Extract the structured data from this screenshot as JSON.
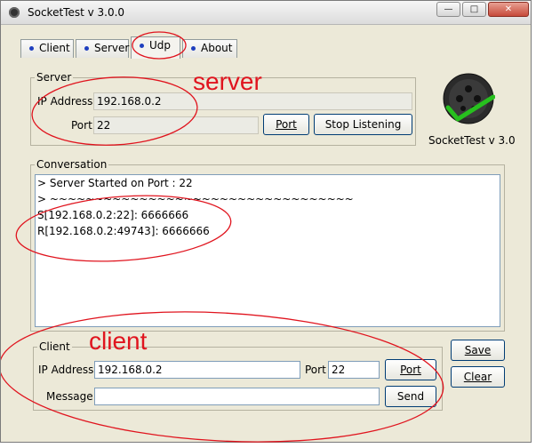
{
  "window": {
    "title": "SocketTest v 3.0.0",
    "controls": {
      "minimize": "—",
      "maximize": "□",
      "close": "✕"
    }
  },
  "tabs": [
    {
      "label": "Client",
      "active": false
    },
    {
      "label": "Server",
      "active": false
    },
    {
      "label": "Udp",
      "active": true
    },
    {
      "label": "About",
      "active": false
    }
  ],
  "server": {
    "group_title": "Server",
    "ip_label": "IP Address",
    "ip_value": "192.168.0.2",
    "port_label": "Port",
    "port_value": "22",
    "port_button": "Port",
    "stop_button": "Stop Listening"
  },
  "logo": {
    "caption": "SocketTest v 3.0"
  },
  "conversation": {
    "group_title": "Conversation",
    "lines": [
      "> Server Started on Port : 22",
      "> ~~~~~~~~~~~~~~~~~~~~~~~~~~~~~~~~~~",
      "S[192.168.0.2:22]: 6666666",
      "R[192.168.0.2:49743]: 6666666"
    ]
  },
  "client": {
    "group_title": "Client",
    "ip_label": "IP Address",
    "ip_value": "192.168.0.2",
    "port_label": "Port",
    "port_value": "22",
    "port_button": "Port",
    "message_label": "Message",
    "message_value": "",
    "send_button": "Send"
  },
  "side_buttons": {
    "save": "Save",
    "clear": "Clear"
  },
  "annotations": {
    "server": "server",
    "client": "client",
    "color": "#e0141e"
  }
}
